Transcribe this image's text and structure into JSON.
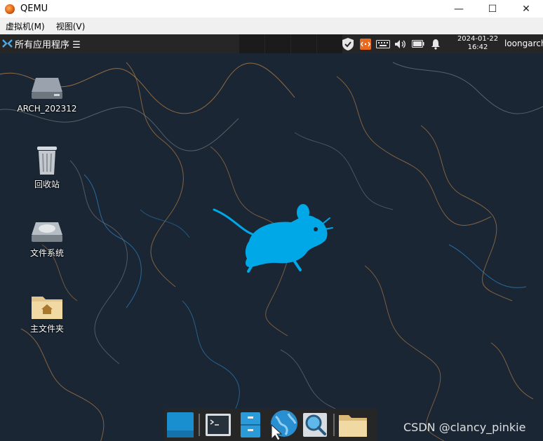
{
  "window": {
    "title": "QEMU",
    "minimize": "—",
    "maximize": "☐",
    "close": "✕"
  },
  "menu": [
    {
      "label": "虚拟机(M)"
    },
    {
      "label": "视图(V)"
    }
  ],
  "panel": {
    "apps_label": "所有应用程序 ☰",
    "date": "2024-01-22",
    "time": "16:42",
    "user": "loongarch"
  },
  "desktop_icons": [
    {
      "label": "ARCH_202312",
      "icon": "drive-icon"
    },
    {
      "label": "回收站",
      "icon": "trash-icon"
    },
    {
      "label": "文件系统",
      "icon": "filesystem-icon"
    },
    {
      "label": "主文件夹",
      "icon": "home-folder-icon"
    }
  ],
  "dock_items": [
    {
      "name": "show-desktop"
    },
    {
      "name": "terminal"
    },
    {
      "name": "file-manager"
    },
    {
      "name": "web-browser"
    },
    {
      "name": "app-finder"
    },
    {
      "name": "home-folder"
    }
  ],
  "watermark": "CSDN @clancy_pinkie",
  "colors": {
    "panel": "#262626",
    "wallpaper": "#1a2634",
    "xfce_blue": "#00a8e8",
    "line_orange": "#c98a4a",
    "line_blue": "#2f88c8"
  }
}
